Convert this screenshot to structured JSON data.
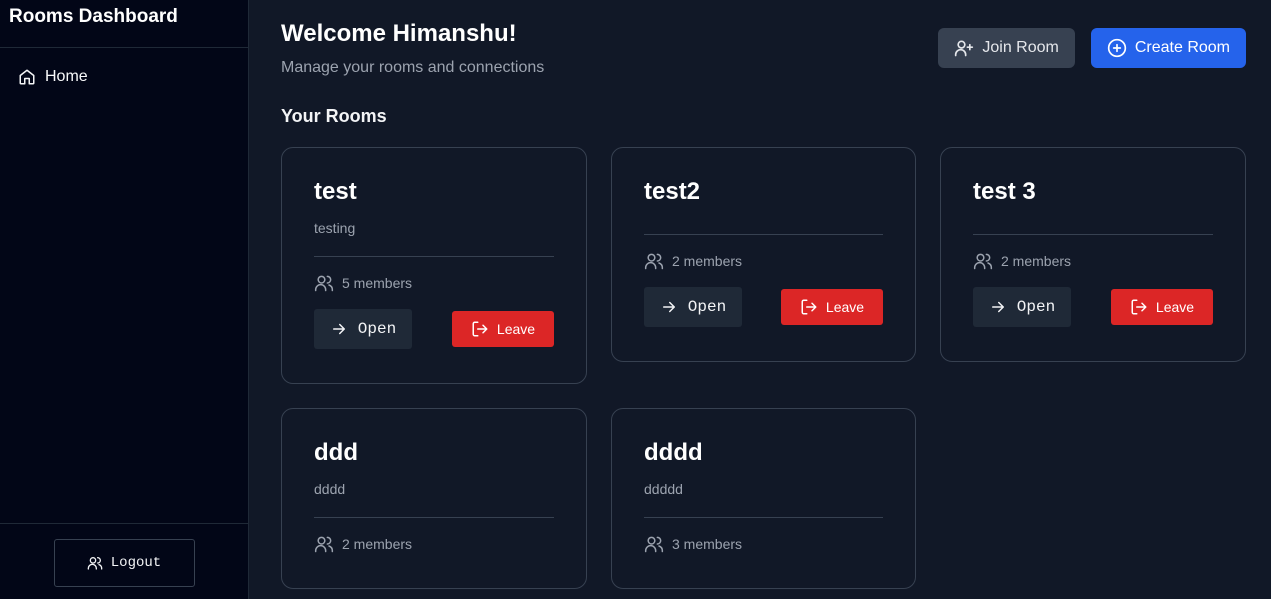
{
  "sidebar": {
    "title": "Rooms Dashboard",
    "nav": [
      {
        "label": "Home",
        "icon": "home-icon"
      }
    ],
    "logout_label": "Logout"
  },
  "header": {
    "welcome": "Welcome Himanshu!",
    "subtitle": "Manage your rooms and connections",
    "join_label": "Join Room",
    "create_label": "Create Room"
  },
  "rooms_section_title": "Your Rooms",
  "rooms": [
    {
      "name": "test",
      "description": "testing",
      "members": "5 members"
    },
    {
      "name": "test2",
      "description": "",
      "members": "2 members"
    },
    {
      "name": "test 3",
      "description": "",
      "members": "2 members"
    },
    {
      "name": "ddd",
      "description": "dddd",
      "members": "2 members"
    },
    {
      "name": "dddd",
      "description": "ddddd",
      "members": "3 members"
    }
  ],
  "room_actions": {
    "open_label": "Open",
    "leave_label": "Leave"
  },
  "colors": {
    "accent": "#2563eb",
    "danger": "#dc2626",
    "background": "#111827",
    "sidebar": "#020617"
  }
}
